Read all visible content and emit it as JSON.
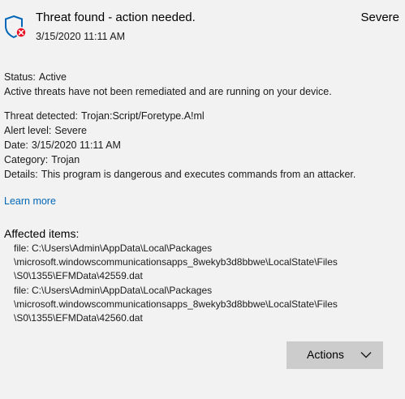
{
  "header": {
    "title": "Threat found - action needed.",
    "date": "3/15/2020 11:11 AM",
    "severity": "Severe",
    "icon": "shield-error-icon"
  },
  "status": {
    "label": "Status:",
    "value": "Active",
    "description": "Active threats have not been remediated and are running on your device."
  },
  "details": [
    {
      "label": "Threat detected:",
      "value": "Trojan:Script/Foretype.A!ml"
    },
    {
      "label": "Alert level:",
      "value": "Severe"
    },
    {
      "label": "Date:",
      "value": "3/15/2020 11:11 AM"
    },
    {
      "label": "Category:",
      "value": "Trojan"
    },
    {
      "label": "Details:",
      "value": "This program is dangerous and executes commands from an attacker."
    }
  ],
  "learn_more": "Learn more",
  "affected": {
    "title": "Affected items:",
    "lines": [
      "file: C:\\Users\\Admin\\AppData\\Local\\Packages",
      "\\microsoft.windowscommunicationsapps_8wekyb3d8bbwe\\LocalState\\Files",
      "\\S0\\1355\\EFMData\\42559.dat",
      "file: C:\\Users\\Admin\\AppData\\Local\\Packages",
      "\\microsoft.windowscommunicationsapps_8wekyb3d8bbwe\\LocalState\\Files",
      "\\S0\\1355\\EFMData\\42560.dat"
    ]
  },
  "actions_button": {
    "label": "Actions"
  },
  "colors": {
    "background": "#f2f2f2",
    "link": "#0067b8",
    "shield": "#0067b8",
    "error_badge": "#e81123",
    "button": "#cccccc"
  }
}
